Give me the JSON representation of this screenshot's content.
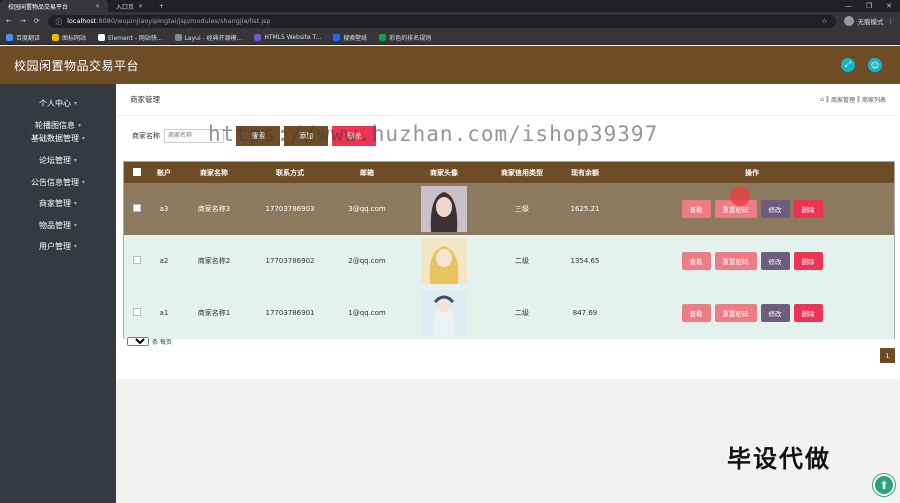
{
  "browser": {
    "tabs": [
      {
        "label": "校园闲置物品交易平台",
        "active": true
      },
      {
        "label": "入口页",
        "active": false
      }
    ],
    "new_tab": "+",
    "url_host": "localhost",
    "url_path": ":8080/wupinjiaoyipingtai/jsp/modules/shangjia/list.jsp",
    "profile_label": "无痕模式",
    "bookmarks": [
      "百度翻译",
      "图标网站",
      "Element - 网站快...",
      "Layui - 经典开源模...",
      "HTML5 Website T...",
      "搜索壁纸",
      "彩色的排名规则"
    ]
  },
  "app": {
    "title": "校园闲置物品交易平台",
    "icons": [
      "fullscreen-icon",
      "user-icon"
    ]
  },
  "sidebar": {
    "items": [
      {
        "label": "个人中心"
      },
      {
        "label": "轮播图信息"
      },
      {
        "label": "基础数据管理"
      },
      {
        "label": "论坛管理"
      },
      {
        "label": "公告信息管理"
      },
      {
        "label": "商家管理"
      },
      {
        "label": "物品管理"
      },
      {
        "label": "用户管理"
      }
    ]
  },
  "main": {
    "breadcrumb_title": "商家管理",
    "breadcrumb_path": [
      "商家管理",
      "商家列表"
    ],
    "search": {
      "label": "商家名称",
      "placeholder": "商家名称",
      "search_button": "搜索",
      "add_button": "添加",
      "delete_button": "删除"
    },
    "watermark": "https://www.huzhan.com/ishop39397",
    "table": {
      "headers": [
        "账户",
        "商家名称",
        "联系方式",
        "邮箱",
        "商家头像",
        "商家信用类型",
        "现有余额",
        "操作"
      ],
      "rows": [
        {
          "account": "a3",
          "name": "商家名称3",
          "phone": "17703786903",
          "email": "3@qq.com",
          "credit": "三级",
          "balance": "1625.21"
        },
        {
          "account": "a2",
          "name": "商家名称2",
          "phone": "17703786902",
          "email": "2@qq.com",
          "credit": "二级",
          "balance": "1354.65"
        },
        {
          "account": "a1",
          "name": "商家名称1",
          "phone": "17703786901",
          "email": "1@qq.com",
          "credit": "二级",
          "balance": "847.69"
        }
      ],
      "ops": {
        "view": "查看",
        "reset": "重置密码",
        "edit": "修改",
        "delete": "删除"
      }
    },
    "page_size": "10",
    "page_size_suffix": "条 每页",
    "current_page": "1",
    "big_text": "毕设代做"
  },
  "colors": {
    "brand": "#6d4c26",
    "danger": "#ee3355",
    "accent": "#17b3c8"
  }
}
